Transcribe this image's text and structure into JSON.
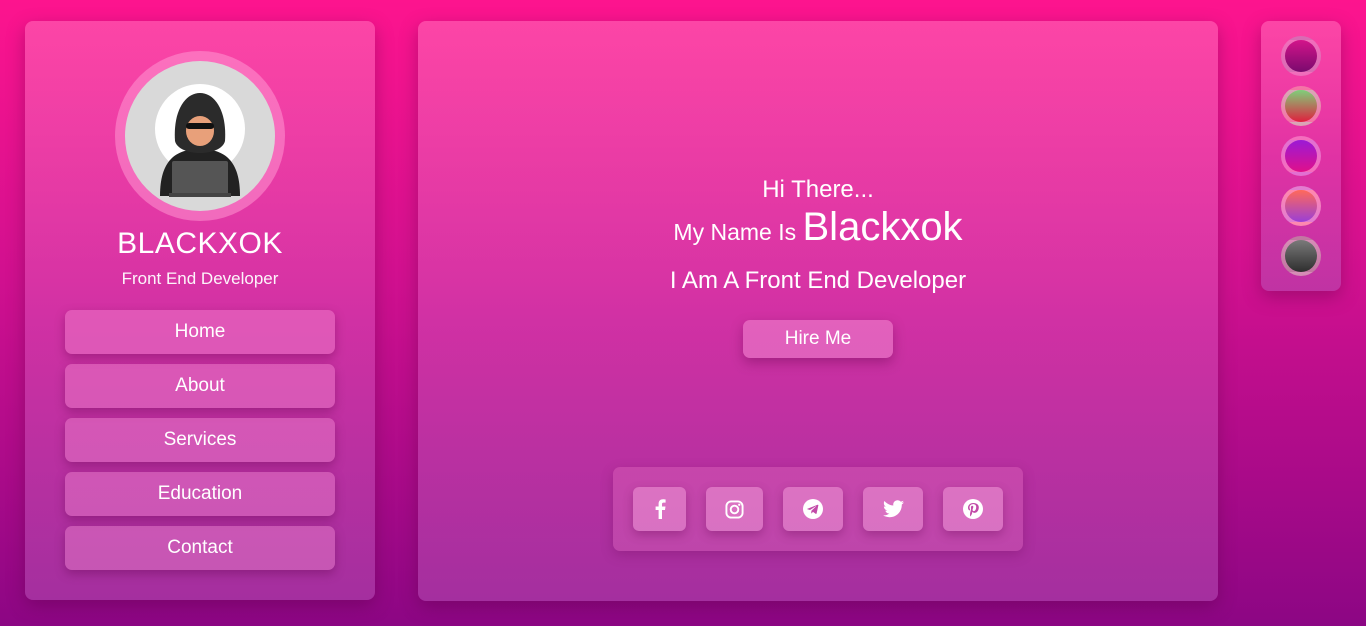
{
  "profile": {
    "name": "BLACKXOK",
    "role": "Front End Developer"
  },
  "nav": {
    "items": [
      {
        "label": "Home"
      },
      {
        "label": "About"
      },
      {
        "label": "Services"
      },
      {
        "label": "Education"
      },
      {
        "label": "Contact"
      }
    ]
  },
  "hero": {
    "greeting": "Hi There...",
    "name_prefix": "My Name Is",
    "name": "Blackxok",
    "role_line": "I Am A Front End Developer",
    "hire_label": "Hire Me"
  },
  "social": {
    "icons": [
      "facebook-icon",
      "instagram-icon",
      "telegram-icon",
      "twitter-icon",
      "pinterest-icon"
    ]
  },
  "themes": {
    "swatches": [
      {
        "top": "#d3148a",
        "bottom": "#7a0a6e"
      },
      {
        "top": "#7fd07a",
        "bottom": "#e0203e"
      },
      {
        "top": "#9b1ad6",
        "bottom": "#e0108a"
      },
      {
        "top": "#ff6a5a",
        "bottom": "#9a3fd6"
      },
      {
        "top": "#7a7a7a",
        "bottom": "#2e2e2e"
      }
    ]
  }
}
